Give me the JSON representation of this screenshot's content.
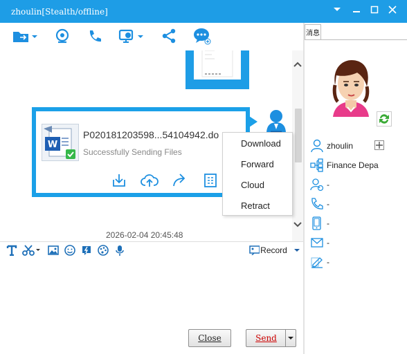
{
  "window": {
    "title": "zhoulin[Stealth/offline]",
    "colors": {
      "accent": "#1e9de6",
      "icon_blue": "#1d8fe0",
      "send_red": "#cc0000"
    }
  },
  "toolbar": {
    "icons": [
      "folder-transfer-icon",
      "webcam-icon",
      "phone-icon",
      "remote-desktop-icon",
      "share-icon",
      "chat-bubble-icon"
    ]
  },
  "chat": {
    "file_message": {
      "file_name": "P020181203598...54104942.do",
      "status": "Successfully Sending Files",
      "actions": [
        "download-icon",
        "cloud-upload-icon",
        "forward-icon",
        "document-icon"
      ]
    },
    "timestamp": "2026-02-04 20:45:48"
  },
  "context_menu": {
    "items": [
      "Download",
      "Forward",
      "Cloud",
      "Retract"
    ]
  },
  "format_bar": {
    "icons": [
      "text-format-icon",
      "scissors-icon",
      "image-icon",
      "emoji-icon",
      "shake-icon",
      "palette-icon",
      "microphone-icon"
    ],
    "record_label": "Record"
  },
  "buttons": {
    "close": "Close",
    "send": "Send"
  },
  "sidebar": {
    "tab": "消息",
    "name": "zhoulin",
    "department": "Finance Depa",
    "fields": [
      "-",
      "-",
      "-",
      "-",
      "-"
    ]
  }
}
